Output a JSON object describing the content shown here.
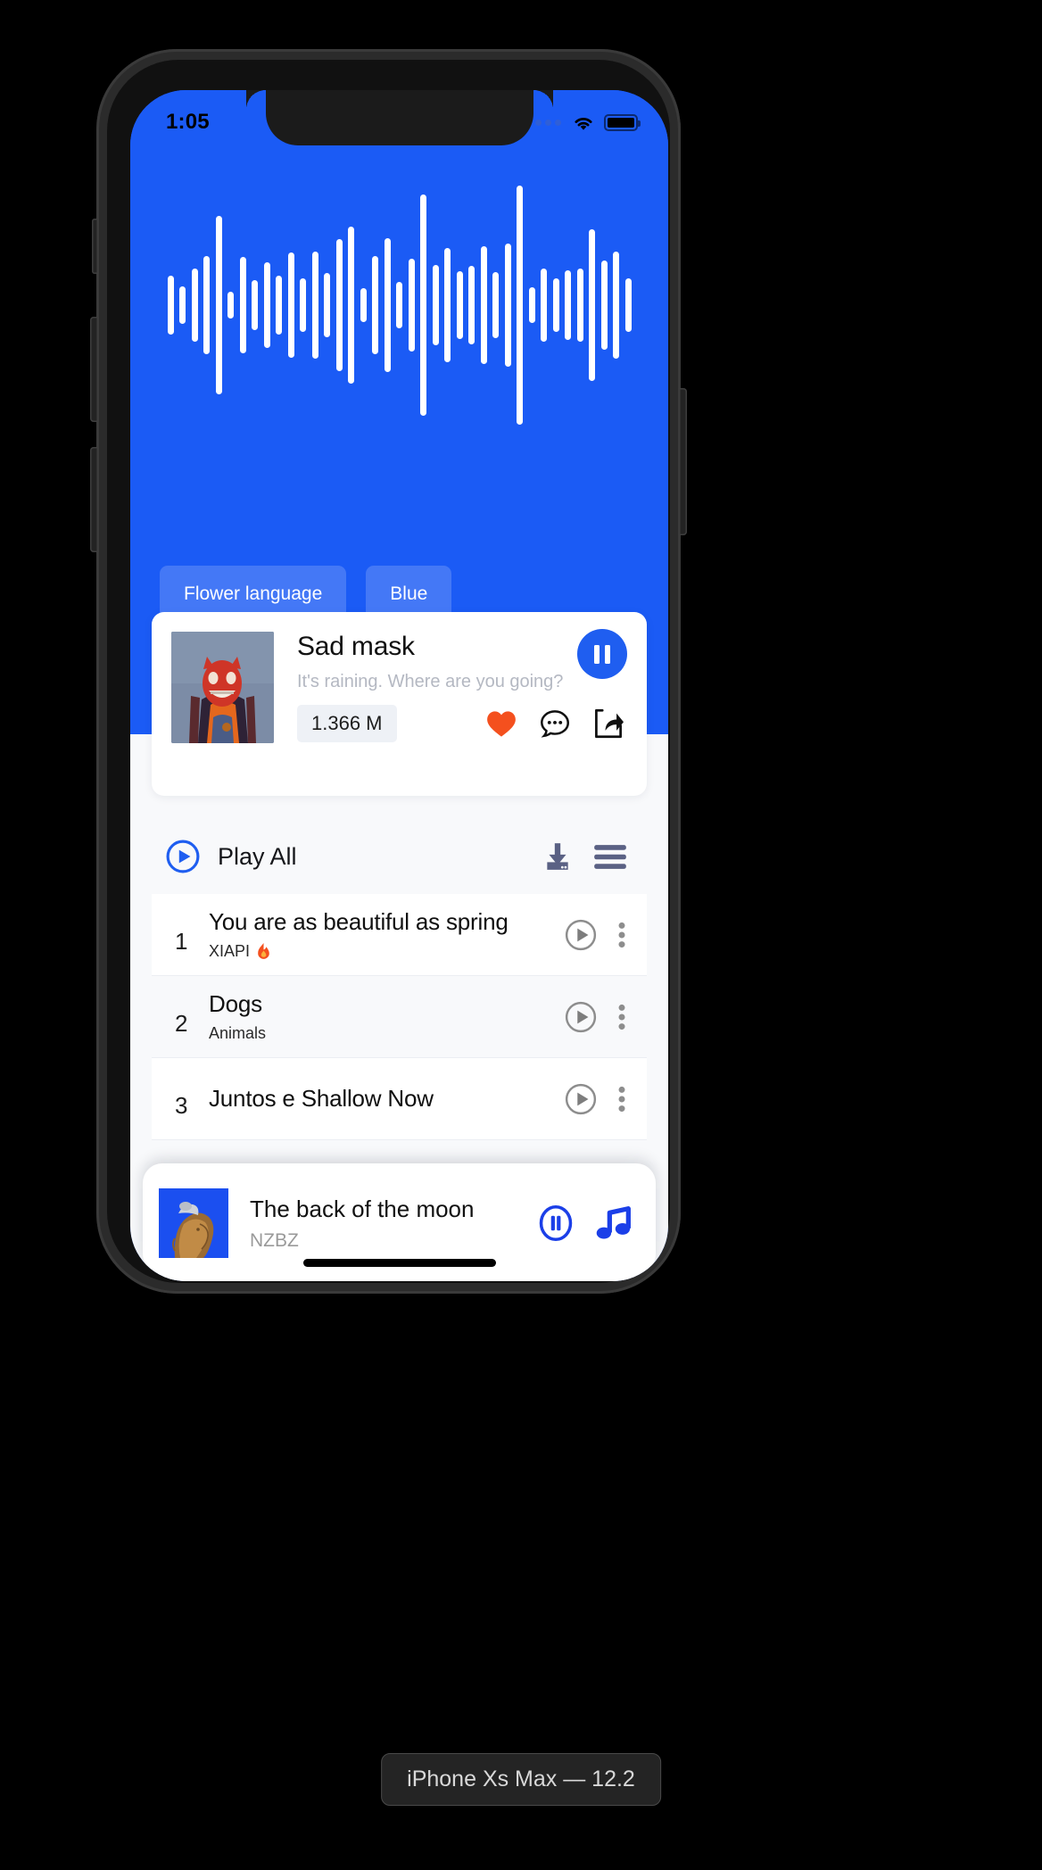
{
  "device": {
    "caption": "iPhone Xs Max — 12.2"
  },
  "statusbar": {
    "time": "1:05",
    "signal_icon": "signal-dots-icon",
    "wifi_icon": "wifi-icon",
    "battery_icon": "battery-icon"
  },
  "hero": {
    "background_color": "#1b5bf5",
    "waveform_icon": "audio-waveform",
    "waveform_heights": [
      66,
      42,
      82,
      110,
      200,
      30,
      108,
      56,
      96,
      66,
      118,
      60,
      120,
      72,
      148,
      176,
      38,
      110,
      150,
      52,
      104,
      248,
      90,
      128,
      76,
      88,
      132,
      74,
      138,
      268,
      40,
      82,
      60,
      78,
      82,
      170,
      100,
      120,
      60
    ],
    "tags": [
      {
        "label": "Flower language"
      },
      {
        "label": "Blue"
      }
    ]
  },
  "now_playing": {
    "artwork_name": "sad-mask-album-art",
    "title": "Sad mask",
    "subtitle": "It's raining. Where are you going?",
    "play_count": "1.366 M",
    "pause_button_icon": "pause-icon",
    "actions": [
      {
        "icon": "heart-icon",
        "color": "#f4501e"
      },
      {
        "icon": "comment-icon",
        "color": "#101010"
      },
      {
        "icon": "share-icon",
        "color": "#101010"
      }
    ]
  },
  "playlist_toolbar": {
    "play_all_icon": "play-circle-icon",
    "play_all_label": "Play All",
    "download_icon": "download-icon",
    "menu_icon": "hamburger-menu-icon",
    "icon_color": "#5a6184"
  },
  "tracks": [
    {
      "num": "1",
      "title": "You are as beautiful as spring",
      "artist": "XIAPI",
      "badge": "fire-icon",
      "play_icon": "play-circle-icon",
      "more_icon": "more-vertical-icon",
      "active": true
    },
    {
      "num": "2",
      "title": "Dogs",
      "artist": "Animals",
      "badge": "",
      "play_icon": "play-circle-icon",
      "more_icon": "more-vertical-icon",
      "active": false
    },
    {
      "num": "3",
      "title": "Juntos e Shallow Now",
      "artist": "",
      "badge": "",
      "play_icon": "play-circle-icon",
      "more_icon": "more-vertical-icon",
      "active": true
    }
  ],
  "mini_player": {
    "artwork_name": "the-back-of-the-moon-album-art",
    "title": "The back of the moon",
    "artist": "NZBZ",
    "pause_icon": "pause-circle-icon",
    "music_note_icon": "music-note-icon",
    "accent_color": "#1b3fe8"
  }
}
